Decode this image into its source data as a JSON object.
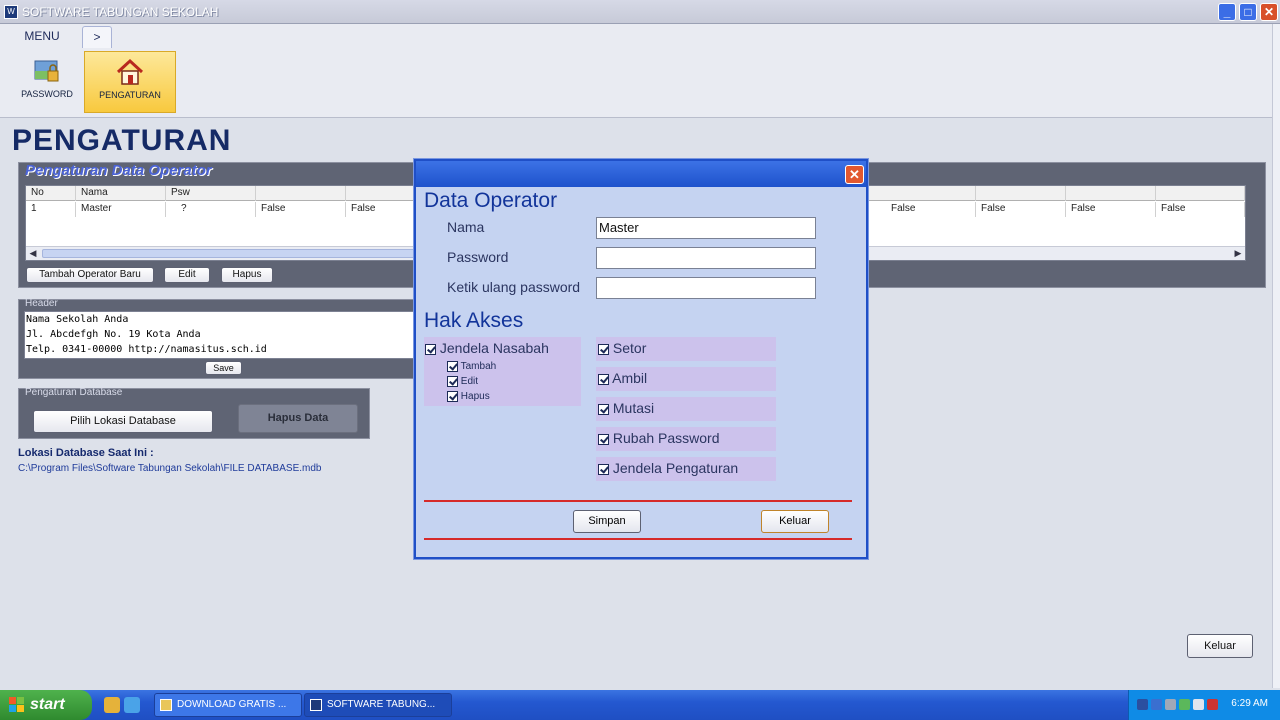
{
  "window": {
    "title": "SOFTWARE TABUNGAN SEKOLAH"
  },
  "ribbon": {
    "tabs": [
      "MENU",
      ">"
    ],
    "buttons": [
      {
        "label": "PASSWORD",
        "icon": "password-icon"
      },
      {
        "label": "PENGATURAN",
        "icon": "house-icon"
      }
    ]
  },
  "page": {
    "title": "PENGATURAN"
  },
  "operator_section": {
    "label": "Pengaturan Data Operator",
    "columns": [
      "No",
      "Nama",
      "Psw"
    ],
    "row": [
      "1",
      "Master",
      "?",
      "False",
      "False",
      "False",
      "False",
      "False",
      "False"
    ],
    "buttons": [
      "Tambah Operator Baru",
      "Edit",
      "Hapus"
    ]
  },
  "header_section": {
    "label": "Header",
    "lines": [
      "Nama Sekolah Anda",
      "Jl. Abcdefgh No. 19 Kota Anda",
      "Telp. 0341-00000 http://namasitus.sch.id"
    ],
    "save_label": "Save"
  },
  "database_section": {
    "label": "Pengaturan Database",
    "select_label": "Pilih Lokasi Database",
    "delete_label": "Hapus Data"
  },
  "lokasi": {
    "label": "Lokasi Database Saat Ini :",
    "path": "C:\\Program Files\\Software Tabungan Sekolah\\FILE DATABASE.mdb"
  },
  "main_exit": "Keluar",
  "dialog": {
    "heading": "Data Operator",
    "fields": [
      {
        "label": "Nama",
        "value": "Master"
      },
      {
        "label": "Password",
        "value": ""
      },
      {
        "label": "Ketik ulang password",
        "value": ""
      }
    ],
    "hak_heading": "Hak Akses",
    "left_perm": "Jendela Nasabah",
    "sub_perms": [
      "Tambah",
      "Edit",
      "Hapus"
    ],
    "right_perms": [
      "Setor",
      "Ambil",
      "Mutasi",
      "Rubah Password",
      "Jendela Pengaturan"
    ],
    "save_label": "Simpan",
    "exit_label": "Keluar"
  },
  "taskbar": {
    "start": "start",
    "tasks": [
      "DOWNLOAD GRATIS ...",
      "SOFTWARE TABUNG..."
    ],
    "clock": "6:29 AM"
  },
  "colors": {
    "accent": "#152a66",
    "dialog_bg": "#c5d3f1",
    "taskbar": "#2458d0"
  }
}
